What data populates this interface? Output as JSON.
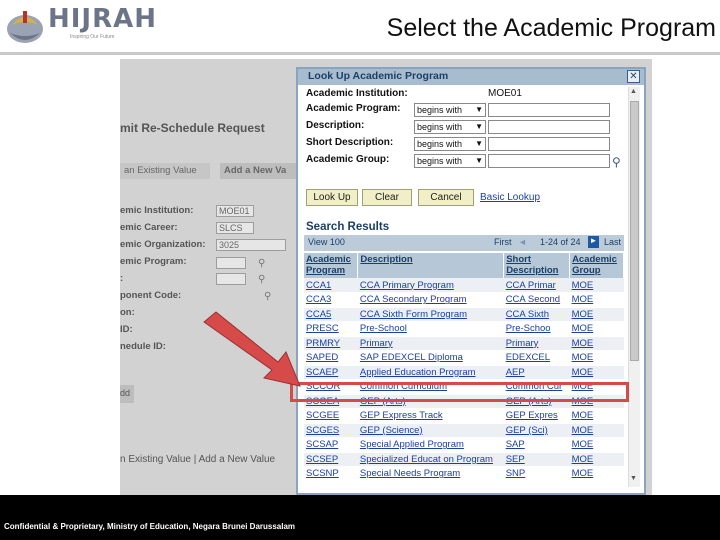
{
  "header": {
    "logo_text": "HIJRAH",
    "logo_tagline": "Inspiring Our Future",
    "slide_title": "Select the Academic Program"
  },
  "background_page": {
    "title": "mit Re-Schedule Request",
    "tabs": [
      "an Existing Value",
      "Add a New Va"
    ],
    "fields": [
      {
        "label": "emic Institution:",
        "value": "MOE01"
      },
      {
        "label": "emic Career:",
        "value": "SLCS"
      },
      {
        "label": "emic Organization:",
        "value": "3025"
      },
      {
        "label": "emic Program:",
        "value": ""
      },
      {
        "label": ":",
        "value": ""
      },
      {
        "label": "ponent Code:",
        "value": ""
      },
      {
        "label": "on:",
        "value": ""
      },
      {
        "label": "ID:",
        "value": ""
      },
      {
        "label": "nedule ID:",
        "value": ""
      }
    ],
    "add_button": "dd",
    "bottom_links": "n Existing Value | Add a New Value"
  },
  "dialog": {
    "title": "Look Up Academic Program",
    "close_icon": "close-icon",
    "institution_label": "Academic Institution:",
    "institution_value": "MOE01",
    "criteria": [
      {
        "label": "Academic Program:",
        "operator": "begins with"
      },
      {
        "label": "Description:",
        "operator": "begins with"
      },
      {
        "label": "Short Description:",
        "operator": "begins with"
      },
      {
        "label": "Academic Group:",
        "operator": "begins with"
      }
    ],
    "buttons": {
      "lookup": "Look Up",
      "clear": "Clear",
      "cancel": "Cancel"
    },
    "basic_lookup": "Basic Lookup",
    "results_title": "Search Results",
    "nav": {
      "view": "View 100",
      "first": "First",
      "prev": "◄",
      "range": "1-24 of 24",
      "next": "►",
      "last": "Last"
    },
    "columns": [
      "Academic Program",
      "Description",
      "Short Description",
      "Academic Group"
    ],
    "rows": [
      [
        "CCA1",
        "CCA Primary Program",
        "CCA Primar",
        "MOE"
      ],
      [
        "CCA3",
        "CCA Secondary Program",
        "CCA Second",
        "MOE"
      ],
      [
        "CCA5",
        "CCA Sixth Form Program",
        "CCA Sixth",
        "MOE"
      ],
      [
        "PRESC",
        "Pre-School",
        "Pre-Schoo",
        "MOE"
      ],
      [
        "PRMRY",
        "Primary",
        "Primary",
        "MOE"
      ],
      [
        "SAPED",
        "SAP EDEXCEL Diploma",
        "EDEXCEL",
        "MOE"
      ],
      [
        "SCAEP",
        "Applied Education Program",
        "AEP",
        "MOE"
      ],
      [
        "SCCOR",
        "Common Curriculum",
        "Common Cur",
        "MOE"
      ],
      [
        "SCGEA",
        "GEP (Arts)",
        "GEP (Arts)",
        "MOE"
      ],
      [
        "SCGEE",
        "GEP Express Track",
        "GEP Expres",
        "MOE"
      ],
      [
        "SCGES",
        "GEP (Science)",
        "GEP (Sci)",
        "MOE"
      ],
      [
        "SCSAP",
        "Special Applied Program",
        "SAP",
        "MOE"
      ],
      [
        "SCSEP",
        "Specialized Educat on Program",
        "SEP",
        "MOE"
      ],
      [
        "SCSNP",
        "Special Needs Program",
        "SNP",
        "MOE"
      ]
    ]
  },
  "footer": {
    "text": "Confidential & Proprietary, Ministry of Education, Negara Brunei Darussalam"
  },
  "colors": {
    "highlight": "#d74a4a",
    "link": "#1a3fa6",
    "dialog_header": "#a8bcd0"
  }
}
